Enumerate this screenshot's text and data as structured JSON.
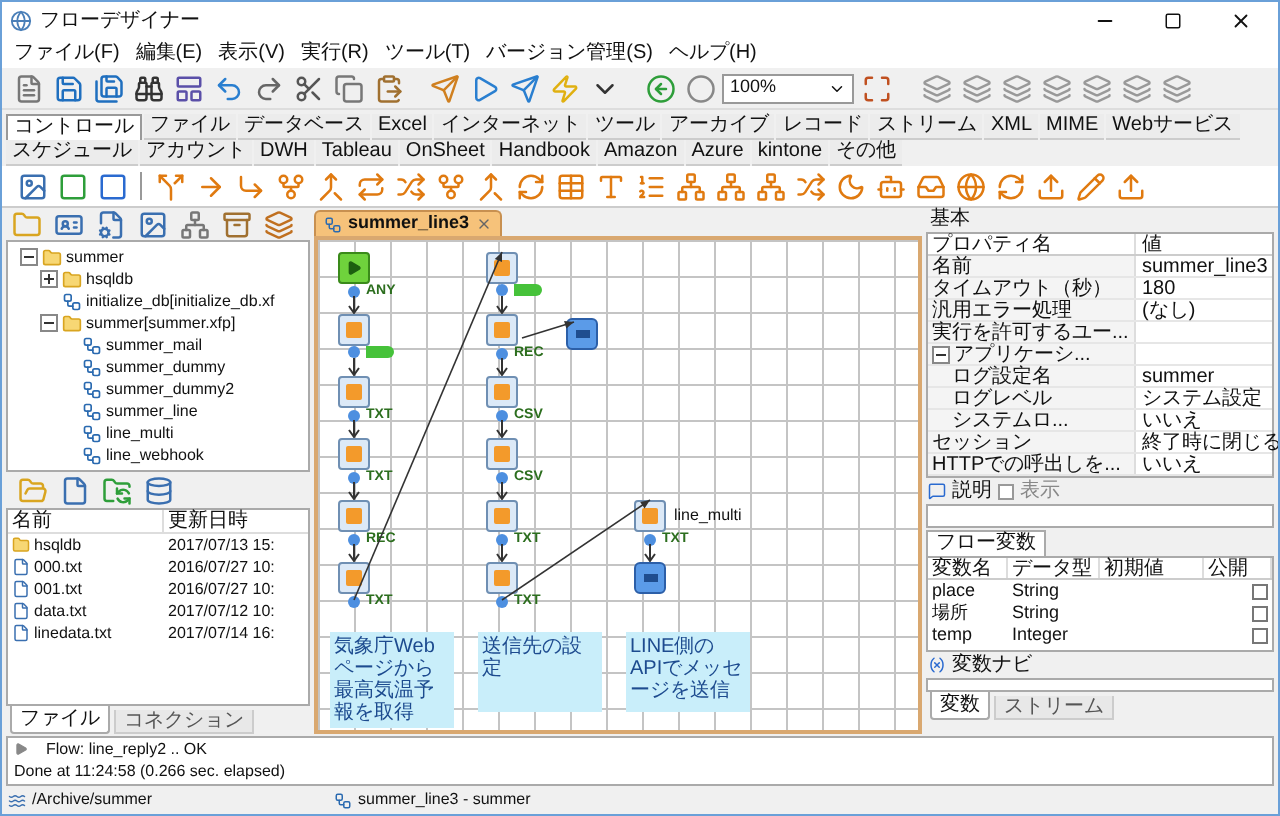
{
  "window": {
    "title": "フローデザイナー"
  },
  "menu": [
    "ファイル(F)",
    "編集(E)",
    "表示(V)",
    "実行(R)",
    "ツール(T)",
    "バージョン管理(S)",
    "ヘルプ(H)"
  ],
  "toolbar": {
    "zoom": "100%"
  },
  "palette_tabs": [
    {
      "label": "コントロール",
      "selected": true
    },
    {
      "label": "ファイル",
      "selected": false
    },
    {
      "label": "データベース",
      "selected": false
    },
    {
      "label": "Excel",
      "selected": false
    },
    {
      "label": "インターネット",
      "selected": false
    },
    {
      "label": "ツール",
      "selected": false
    },
    {
      "label": "アーカイブ",
      "selected": false
    },
    {
      "label": "レコード",
      "selected": false
    },
    {
      "label": "ストリーム",
      "selected": false
    },
    {
      "label": "XML",
      "selected": false
    },
    {
      "label": "MIME",
      "selected": false
    },
    {
      "label": "Webサービス",
      "selected": false
    },
    {
      "label": "スケジュール",
      "selected": false
    },
    {
      "label": "アカウント",
      "selected": false
    },
    {
      "label": "DWH",
      "selected": false
    },
    {
      "label": "Tableau",
      "selected": false
    },
    {
      "label": "OnSheet",
      "selected": false
    },
    {
      "label": "Handbook",
      "selected": false
    },
    {
      "label": "Amazon",
      "selected": false
    },
    {
      "label": "Azure",
      "selected": false
    },
    {
      "label": "kintone",
      "selected": false
    },
    {
      "label": "その他",
      "selected": false
    }
  ],
  "project_tree": [
    {
      "label": "summer",
      "expanded": true,
      "children": [
        {
          "label": "hsqldb",
          "expanded": false
        },
        {
          "label": "initialize_db[initialize_db.xf"
        },
        {
          "label": "summer[summer.xfp]",
          "expanded": true,
          "children": [
            {
              "label": "summer_mail"
            },
            {
              "label": "summer_dummy"
            },
            {
              "label": "summer_dummy2"
            },
            {
              "label": "summer_line"
            },
            {
              "label": "line_multi"
            },
            {
              "label": "line_webhook"
            }
          ]
        }
      ]
    }
  ],
  "file_list": {
    "columns": [
      "名前",
      "更新日時"
    ],
    "rows": [
      {
        "kind": "folder",
        "name": "hsqldb",
        "modified": "2017/07/13 15:"
      },
      {
        "kind": "file",
        "name": "000.txt",
        "modified": "2016/07/27 10:"
      },
      {
        "kind": "file",
        "name": "001.txt",
        "modified": "2016/07/27 10:"
      },
      {
        "kind": "file",
        "name": "data.txt",
        "modified": "2017/07/12 10:"
      },
      {
        "kind": "file",
        "name": "linedata.txt",
        "modified": "2017/07/14 16:"
      }
    ]
  },
  "left_tabs": [
    {
      "label": "ファイル",
      "selected": true
    },
    {
      "label": "コネクション",
      "selected": false
    }
  ],
  "editor_tab": {
    "label": "summer_line3",
    "selected": true
  },
  "flow": {
    "columns": [
      {
        "comment": "気象庁Webページから最高気温予報を取得",
        "steps": [
          {
            "kind": "start",
            "port": "ANY"
          },
          {
            "kind": "module",
            "tag": true
          },
          {
            "kind": "module",
            "port": "TXT"
          },
          {
            "kind": "module",
            "port": "TXT"
          },
          {
            "kind": "module",
            "port": "REC"
          },
          {
            "kind": "module",
            "port": "TXT"
          }
        ]
      },
      {
        "comment": "送信先の設定",
        "steps": [
          {
            "kind": "module",
            "tag": true
          },
          {
            "kind": "module",
            "port": "REC",
            "branch": {
              "kind": "end"
            }
          },
          {
            "kind": "module",
            "port": "CSV"
          },
          {
            "kind": "module",
            "port": "CSV"
          },
          {
            "kind": "module",
            "port": "TXT"
          },
          {
            "kind": "module",
            "port": "TXT"
          }
        ]
      },
      {
        "comment": "LINE側のAPIでメッセージを送信",
        "steps": [
          {
            "kind": "module",
            "port": "TXT",
            "label": "line_multi"
          },
          {
            "kind": "end"
          }
        ]
      }
    ]
  },
  "log": [
    "Flow: line_reply2 .. OK",
    "Done at 11:24:58 (0.266 sec. elapsed)"
  ],
  "status_bar": {
    "path": "/Archive/summer",
    "flow": "summer_line3 - summer"
  },
  "properties": {
    "section": "基本",
    "columns": [
      "プロパティ名",
      "値"
    ],
    "rows": [
      {
        "name": "名前",
        "value": "summer_line3"
      },
      {
        "name": "タイムアウト（秒）",
        "value": "180"
      },
      {
        "name": "汎用エラー処理",
        "value": "(なし)"
      },
      {
        "name": "実行を許可するユー..."
      },
      {
        "name": "アプリケーシ...",
        "expanded": true,
        "children": [
          {
            "name": "ログ設定名",
            "value": "summer"
          },
          {
            "name": "ログレベル",
            "value": "システム設定"
          },
          {
            "name": "システムロ...",
            "value": "いいえ"
          }
        ]
      },
      {
        "name": "セッション",
        "value": "終了時に閉じる"
      },
      {
        "name": "HTTPでの呼出しを...",
        "value": "いいえ"
      }
    ]
  },
  "description": {
    "label": "説明",
    "show": {
      "label": "表示",
      "checked": false
    }
  },
  "variables": {
    "tab": "フロー変数",
    "columns": [
      "変数名",
      "データ型",
      "初期値",
      "公開"
    ],
    "rows": [
      {
        "name": "place",
        "type": "String",
        "public": false
      },
      {
        "name": "場所",
        "type": "String",
        "public": false
      },
      {
        "name": "temp",
        "type": "Integer",
        "public": false
      }
    ]
  },
  "navigator": {
    "label": "変数ナビ"
  },
  "right_tabs": [
    {
      "label": "変数",
      "selected": true
    },
    {
      "label": "ストリーム",
      "selected": false
    }
  ]
}
